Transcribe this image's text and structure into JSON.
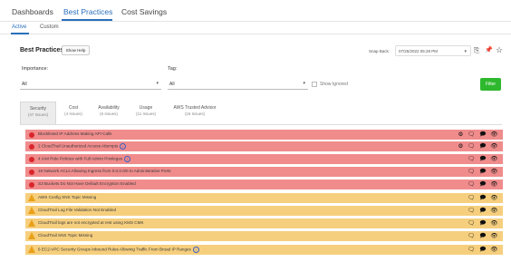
{
  "nav": {
    "tabs": [
      "Dashboards",
      "Best Practices",
      "Cost Savings"
    ],
    "active_tab": "Best Practices",
    "sub_tabs": [
      "Active",
      "Custom"
    ],
    "active_sub_tab": "Active"
  },
  "header": {
    "title": "Best Practices",
    "help_button": "Show Help",
    "snapback_label": "Snap Back:",
    "snapback_value": "07/25/2022 05:28 PM"
  },
  "filters": {
    "importance_label": "Importance:",
    "importance_value": "All",
    "tag_label": "Tag:",
    "tag_value": "All",
    "show_ignored_label": "Show Ignored",
    "filter_button": "Filter"
  },
  "category_tabs": [
    {
      "name": "Security",
      "count": "(47 Issues)"
    },
    {
      "name": "Cost",
      "count": "(4 Issues)"
    },
    {
      "name": "Availability",
      "count": "(6 Issues)"
    },
    {
      "name": "Usage",
      "count": "(11 Issues)"
    },
    {
      "name": "AWS Trusted Advisor",
      "count": "(16 Issues)"
    }
  ],
  "issues": [
    {
      "severity": "high",
      "text": "Blocklisted IP Address Making API Calls",
      "info": false,
      "actions": "⚙ 🗨 🗩 👁"
    },
    {
      "severity": "high",
      "text": "2 CloudTrail Unauthorized Access Attempts",
      "info": true,
      "actions": "⚙ 🗨 🗩 👁"
    },
    {
      "severity": "high",
      "text": "4 IAM Role Policies with Full Admin Privileges",
      "info": true,
      "actions": "🗨 🗩 👁"
    },
    {
      "severity": "high",
      "text": "19 Network ACLs Allowing Ingress from 0.0.0.0/0 to Administrative Ports",
      "info": false,
      "actions": "🗨 🗩 👁"
    },
    {
      "severity": "high",
      "text": "S3 Buckets Do Not Have Default Encryption Enabled",
      "info": false,
      "actions": "🗨 🗩 👁"
    },
    {
      "severity": "medium",
      "text": "AWS Config SNS Topic Missing",
      "info": false,
      "actions": "🗨 🗩 👁"
    },
    {
      "severity": "medium",
      "text": "CloudTrail Log File Validation Not Enabled",
      "info": false,
      "actions": "🗨 🗩 👁"
    },
    {
      "severity": "medium",
      "text": "CloudTrail logs are not encrypted at rest using KMS CMK",
      "info": false,
      "actions": "🗨 🗩 👁"
    },
    {
      "severity": "medium",
      "text": "CloudTrail SNS Topic Missing",
      "info": false,
      "actions": "🗨 🗩 👁"
    },
    {
      "severity": "medium",
      "text": "6 EC2-VPC Security Groups Inbound Rules Allowing Traffic From Broad IP Ranges",
      "info": true,
      "actions": "🗨 🗩 👁"
    }
  ],
  "icons": {
    "row_info": "i",
    "header_export": "⎘",
    "header_pin": "📌",
    "header_star": "☆"
  },
  "colors": {
    "accent": "#2a6ebb",
    "high_row": "#f08c8c",
    "medium_row": "#f6cf7e",
    "filter_button": "#2eb82e"
  }
}
